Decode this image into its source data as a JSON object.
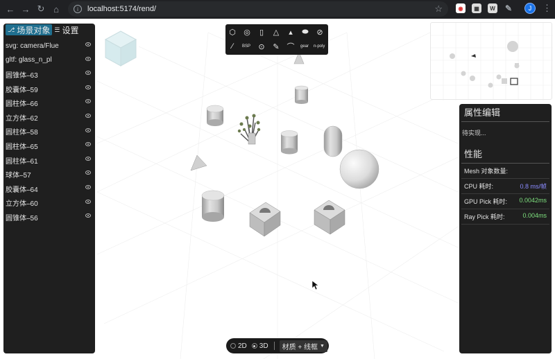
{
  "browser": {
    "url": "localhost:5174/rend/",
    "profile_initial": "J",
    "ext_w_label": "W"
  },
  "left_panel": {
    "tabs": [
      {
        "label": "场景对象",
        "icon": "hierarchy-icon",
        "active": true
      },
      {
        "label": "设置",
        "icon": "sliders-icon",
        "active": false
      }
    ],
    "items": [
      {
        "label": "svg: camera/Flue"
      },
      {
        "label": "gltf: glass_n_pl"
      },
      {
        "label": "圆锥体–63"
      },
      {
        "label": "胶囊体–59"
      },
      {
        "label": "圆柱体–66"
      },
      {
        "label": "立方体–62"
      },
      {
        "label": "圆柱体–58"
      },
      {
        "label": "圆柱体–65"
      },
      {
        "label": "圆柱体–61"
      },
      {
        "label": "球体–57"
      },
      {
        "label": "胶囊体–64"
      },
      {
        "label": "立方体–60"
      },
      {
        "label": "圆锥体–56"
      }
    ]
  },
  "toolbar": {
    "row1": [
      "box-icon",
      "sphere-icon",
      "cylinder-icon",
      "cone-icon",
      "tetrahedron-icon",
      "capsule-icon",
      "torus-icon"
    ],
    "row2": [
      {
        "icon": "line-icon",
        "label": ""
      },
      {
        "icon": "",
        "label": "BSP"
      },
      {
        "icon": "circle-dot-icon",
        "label": ""
      },
      {
        "icon": "pen-icon",
        "label": ""
      },
      {
        "icon": "arc-icon",
        "label": ""
      },
      {
        "icon": "",
        "label": "gear"
      },
      {
        "icon": "",
        "label": "n-poly"
      }
    ]
  },
  "right_panel": {
    "props_title": "属性编辑",
    "props_placeholder": "待实现...",
    "perf_title": "性能",
    "mesh_count_label": "Mesh 对象数量:",
    "mesh_count_value": "",
    "rows": [
      {
        "label": "CPU 耗时:",
        "value": "0.8 ms/帧",
        "color": "#8b8bff"
      },
      {
        "label": "GPU Pick 耗时:",
        "value": "0.0042ms",
        "color": "#7ee07e"
      },
      {
        "label": "Ray Pick 耗时:",
        "value": "0.004ms",
        "color": "#7ee07e"
      }
    ]
  },
  "bottom_bar": {
    "mode_2d": "2D",
    "mode_3d": "3D",
    "selected_mode": "3D",
    "material_select": "材质 + 线框"
  }
}
